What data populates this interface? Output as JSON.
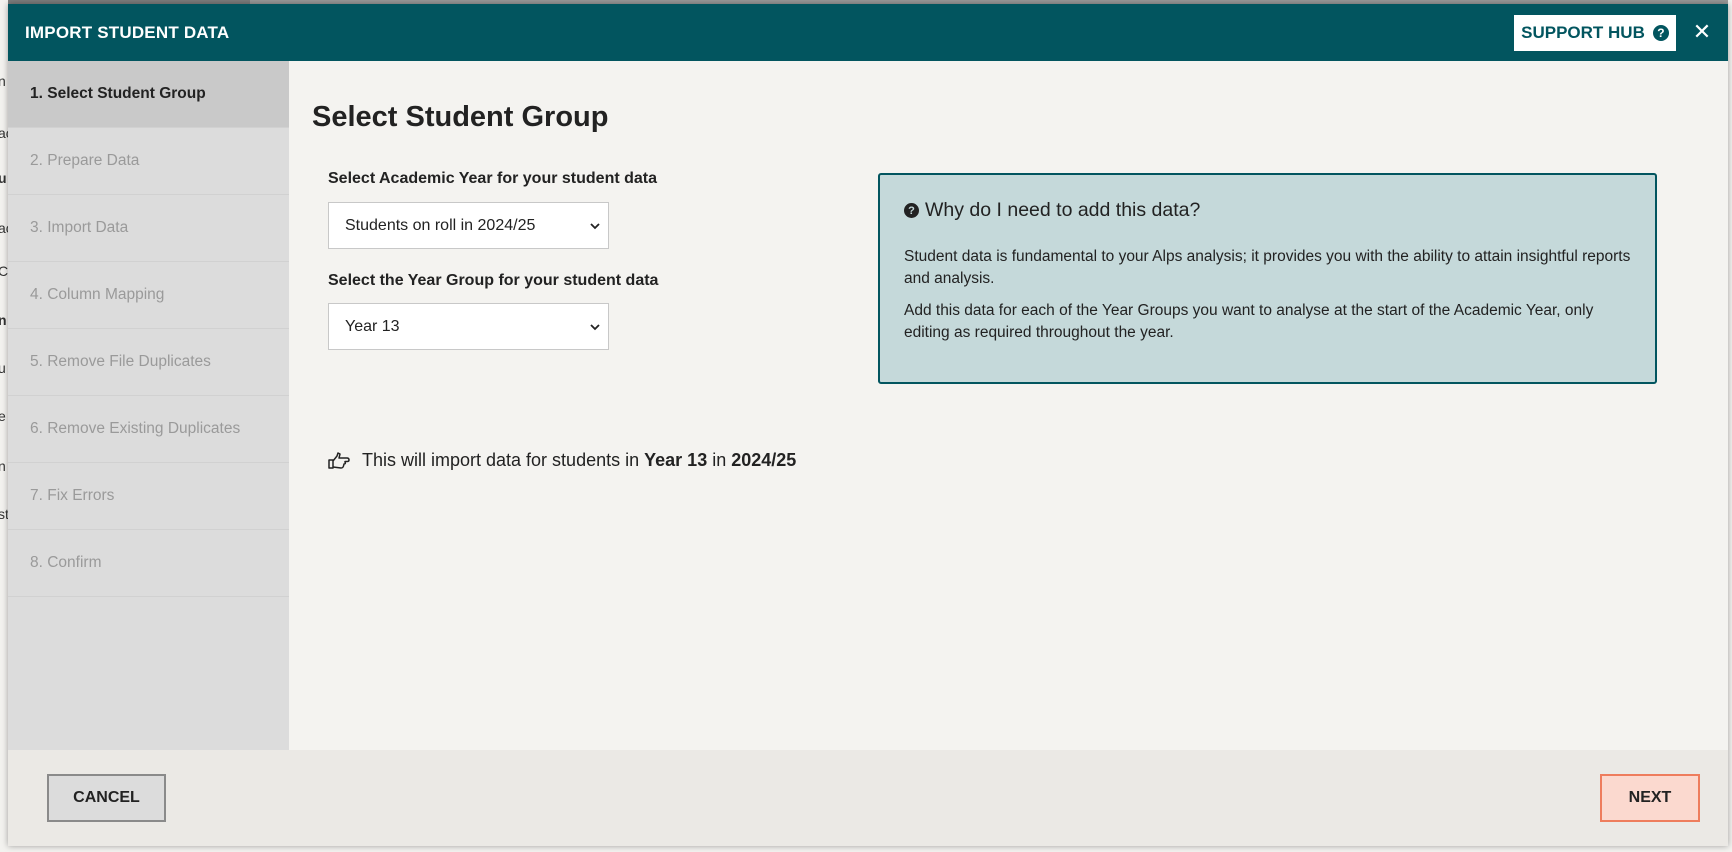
{
  "modal": {
    "title": "IMPORT STUDENT DATA",
    "support_label": "SUPPORT HUB",
    "support_icon": "question-circle-icon",
    "close_glyph": "✕"
  },
  "steps": [
    {
      "label": "1. Select Student Group",
      "active": true
    },
    {
      "label": "2. Prepare Data",
      "active": false
    },
    {
      "label": "3. Import Data",
      "active": false
    },
    {
      "label": "4. Column Mapping",
      "active": false
    },
    {
      "label": "5. Remove File Duplicates",
      "active": false
    },
    {
      "label": "6. Remove Existing Duplicates",
      "active": false
    },
    {
      "label": "7. Fix Errors",
      "active": false
    },
    {
      "label": "8. Confirm",
      "active": false
    }
  ],
  "main": {
    "title": "Select Student Group",
    "academic_year_label": "Select Academic Year for your student data",
    "academic_year_value": "Students on roll in 2024/25",
    "year_group_label": "Select the Year Group for your student data",
    "year_group_value": "Year 13",
    "summary": {
      "prefix": "This will import data for students in",
      "year_group": "Year 13",
      "middle": "in",
      "year": "2024/25",
      "icon": "hand-point-right-icon"
    }
  },
  "info": {
    "title": "Why do I need to add this data?",
    "p1": "Student data is fundamental to your Alps analysis; it provides you with the ability to attain insightful reports and analysis.",
    "p2": "Add this data for each of the Year Groups you want to analyse at the start of the Academic Year, only editing as required throughout the year."
  },
  "footer": {
    "cancel_label": "CANCEL",
    "next_label": "NEXT"
  },
  "colors": {
    "header": "#02555f",
    "info_bg": "#c5d9da",
    "next_border": "#ee7d5d"
  }
}
